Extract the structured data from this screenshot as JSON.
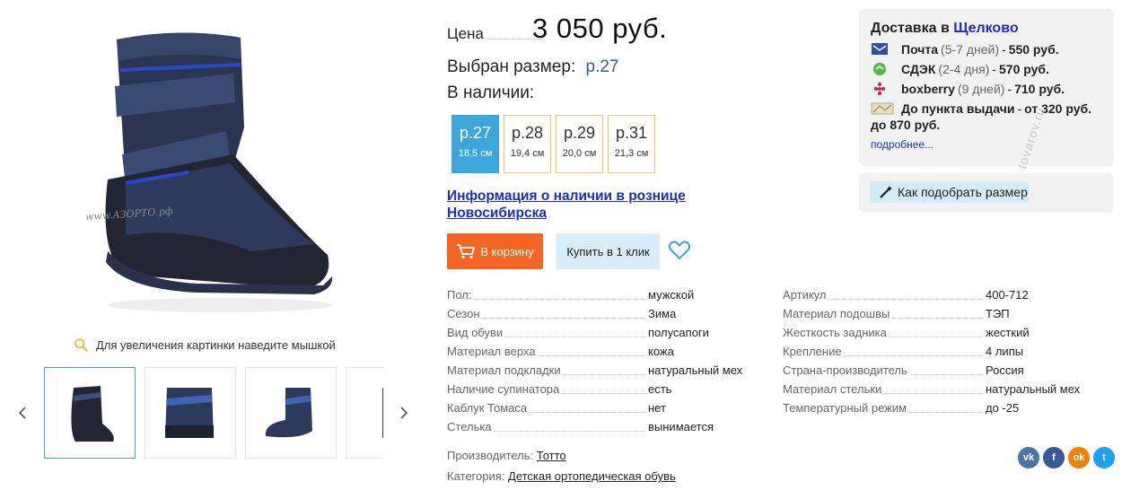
{
  "gallery": {
    "watermark": "www.АЗОРТО.рф",
    "zoom_hint": "Для увеличения картинки наведите мышкой",
    "main_image_icon": "boot-photo",
    "thumbnails": [
      "boot-front-view",
      "boot-side-view",
      "boot-back-view",
      "boot-partial-view"
    ]
  },
  "price": {
    "label": "Цена",
    "value": "3 050 руб."
  },
  "size": {
    "chosen_label": "Выбран размер:",
    "chosen_value": "р.27",
    "in_stock_label": "В наличии:",
    "options": [
      {
        "size": "р.27",
        "cm": "18,5 см",
        "selected": true
      },
      {
        "size": "р.28",
        "cm": "19,4 см",
        "selected": false
      },
      {
        "size": "р.29",
        "cm": "20,0 см",
        "selected": false
      },
      {
        "size": "р.31",
        "cm": "21,3 см",
        "selected": false
      }
    ]
  },
  "retail_link": "Информация о наличии в рознице Новосибирска",
  "actions": {
    "cart_label": "В корзину",
    "oneclick_label": "Купить в 1 клик",
    "accent_color": "#f26522"
  },
  "specs_left": [
    {
      "key": "Пол:",
      "value": "мужской"
    },
    {
      "key": "Сезон",
      "value": "Зима"
    },
    {
      "key": "Вид обуви",
      "value": "полусапоги"
    },
    {
      "key": "Материал верха",
      "value": "кожа"
    },
    {
      "key": "Материал подкладки",
      "value": "натуральный мех"
    },
    {
      "key": "Наличие супинатора",
      "value": "есть"
    },
    {
      "key": "Каблук Томаса",
      "value": "нет"
    },
    {
      "key": "Стелька",
      "value": "вынимается"
    }
  ],
  "specs_right": [
    {
      "key": "Артикул",
      "value": "400-712"
    },
    {
      "key": "Материал подошвы",
      "value": "ТЭП"
    },
    {
      "key": "Жесткость задника",
      "value": "жесткий"
    },
    {
      "key": "Крепление",
      "value": "4 липы"
    },
    {
      "key": "Страна-производитель",
      "value": "Россия"
    },
    {
      "key": "Материал стельки",
      "value": "натуральный мех"
    },
    {
      "key": "Температурный режим",
      "value": "до -25"
    }
  ],
  "maker": {
    "label": "Производитель:",
    "value": "Тотто"
  },
  "category": {
    "label": "Категория:",
    "value": "Детская ортопедическая обувь"
  },
  "delivery": {
    "title": "Доставка в",
    "city": "Щелково",
    "options": [
      {
        "icon": "post-icon",
        "name": "Почта",
        "term": "(5-7 дней)",
        "price": "550 руб."
      },
      {
        "icon": "cdek-icon",
        "name": "СДЭК",
        "term": "(2-4 дня)",
        "price": "570 руб."
      },
      {
        "icon": "boxberry-icon",
        "name": "boxberry",
        "term": "(9 дней)",
        "price": "710 руб."
      }
    ],
    "pickup_name": "До пункта выдачи",
    "pickup_price": "от 320 руб.",
    "pickup_wrap": "до 870 руб.",
    "more": "подробнее..."
  },
  "size_help": "Как подобрать размер",
  "watermark_right": "tovarov.ru",
  "share": [
    {
      "icon": "vk-icon",
      "text": "vk",
      "color": "#4c75a3"
    },
    {
      "icon": "facebook-icon",
      "text": "f",
      "color": "#3b5998"
    },
    {
      "icon": "odnoklassniki-icon",
      "text": "ok",
      "color": "#ee8208"
    },
    {
      "icon": "twitter-icon",
      "text": "t",
      "color": "#1da1f2"
    }
  ]
}
